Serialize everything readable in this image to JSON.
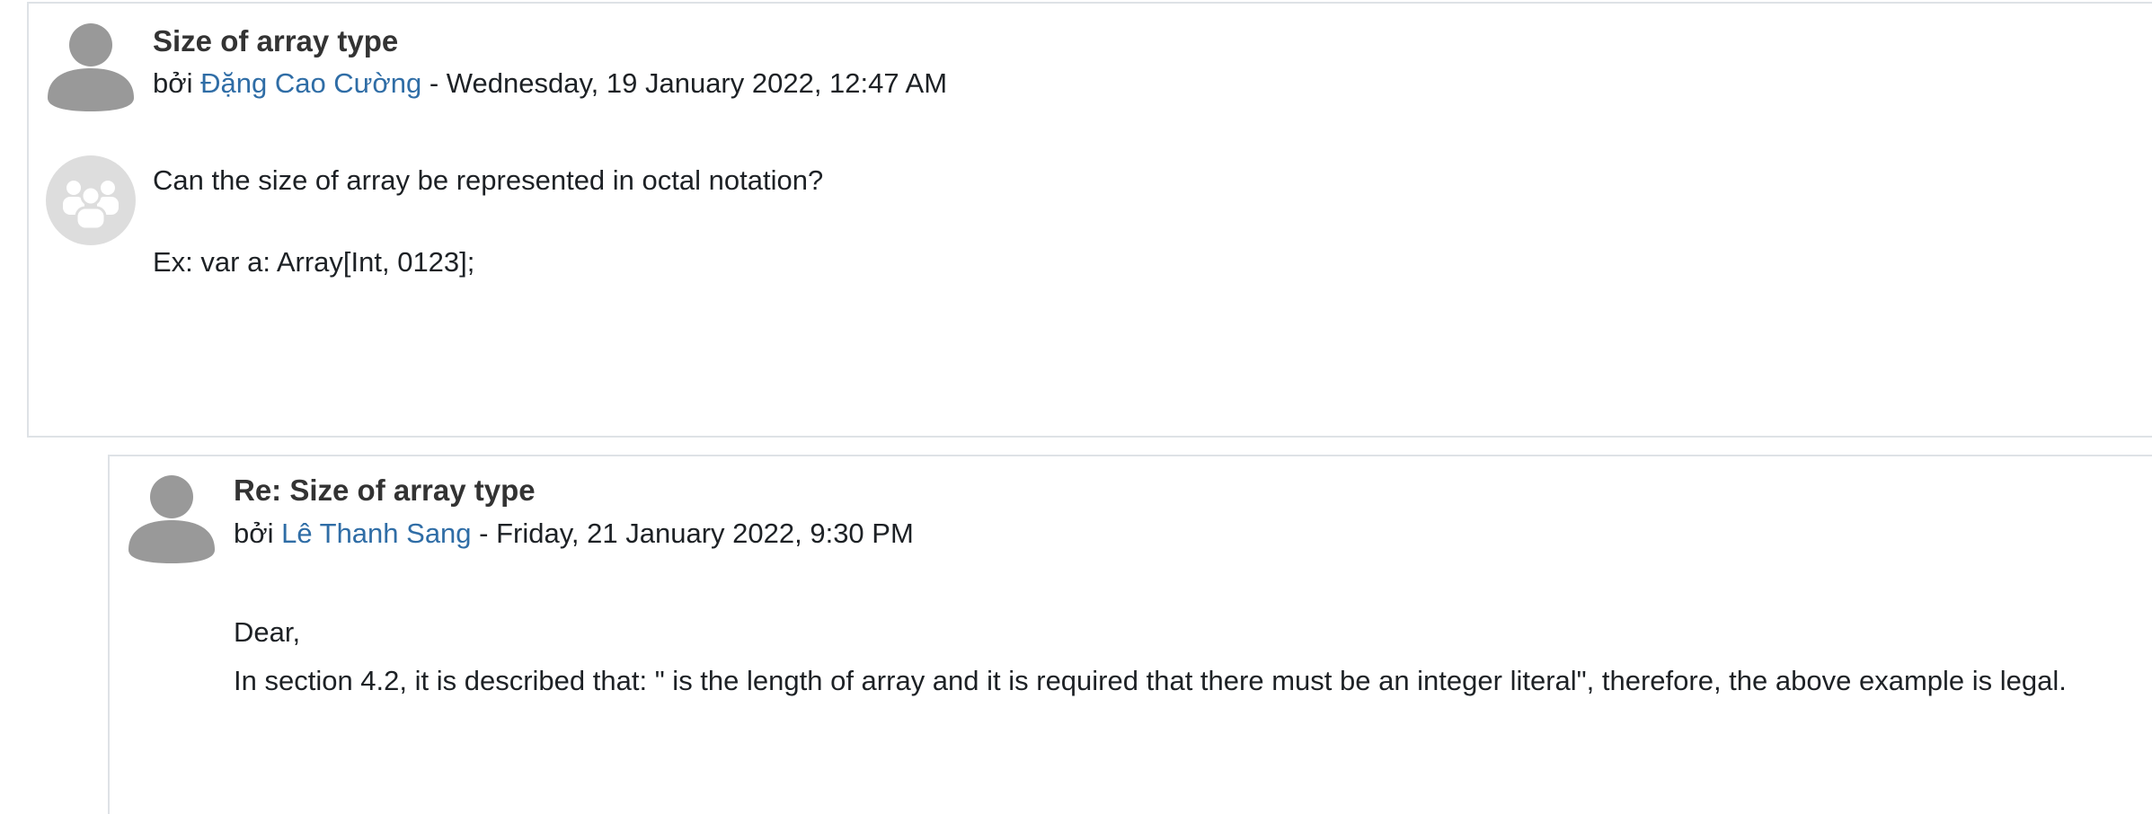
{
  "posts": [
    {
      "subject": "Size of array type",
      "by_prefix": "bởi",
      "author": "Đặng Cao Cường",
      "date": "- Wednesday, 19 January 2022, 12:47 AM",
      "content": [
        "Can the size of array be represented in octal notation?",
        "Ex: var a: Array[Int, 0123];"
      ]
    },
    {
      "subject": "Re: Size of array type",
      "by_prefix": "bởi",
      "author": "Lê Thanh Sang",
      "date": "- Friday, 21 January 2022, 9:30 PM",
      "content": [
        "Dear,",
        "In section 4.2, it is described that: \" is the length of array and it is required that there must be an integer literal\", therefore, the above example is legal."
      ]
    }
  ],
  "icons": {
    "user_avatar": "user-silhouette",
    "group_avatar": "group-people"
  },
  "colors": {
    "link": "#2f6da6",
    "avatar": "#999999",
    "group_avatar_bg": "#dddddd",
    "border": "#dee2e6"
  }
}
